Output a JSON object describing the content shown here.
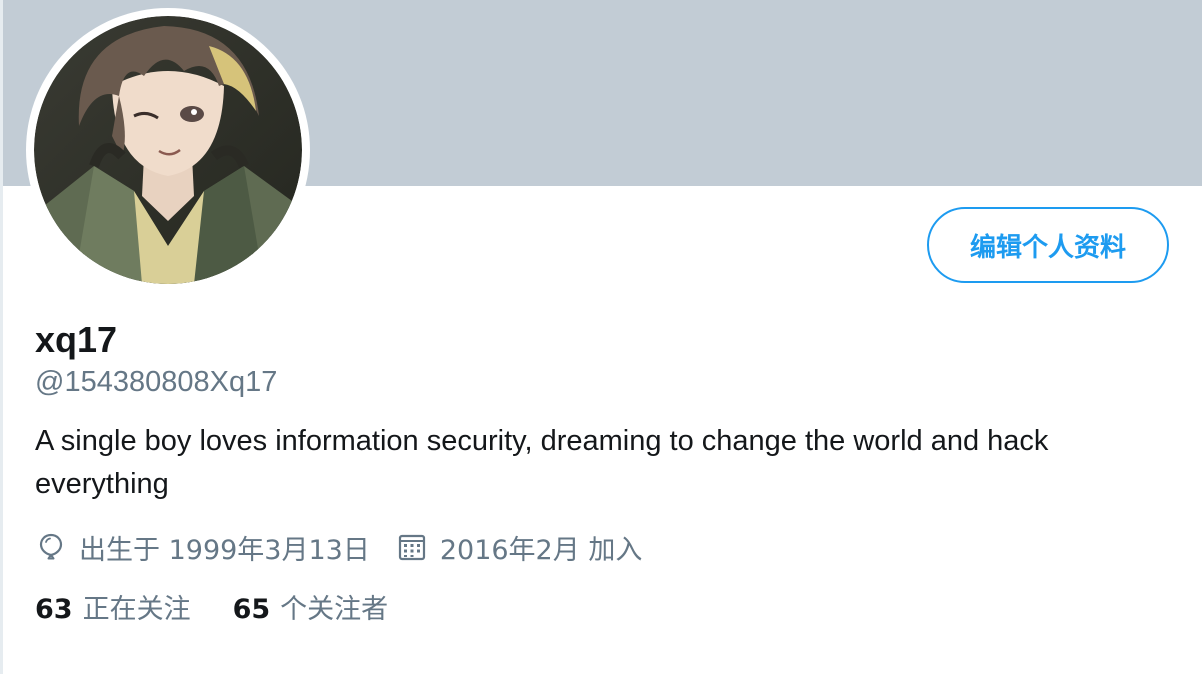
{
  "profile": {
    "display_name": "xq17",
    "handle": "@154380808Xq17",
    "bio": "A single boy loves information security, dreaming to change the world and hack everything",
    "birthday": "出生于 1999年3月13日",
    "joined": "2016年2月 加入",
    "avatar_icon": "anime-boy-avatar"
  },
  "actions": {
    "edit_profile_label": "编辑个人资料"
  },
  "stats": {
    "following_count": "63",
    "following_label": "正在关注",
    "followers_count": "65",
    "followers_label": "个关注者"
  },
  "icons": {
    "birthday": "balloon-icon",
    "joined": "calendar-icon"
  },
  "colors": {
    "banner": "#c2ccd5",
    "accent": "#1d9bf0",
    "secondary_text": "#657786",
    "primary_text": "#14171a"
  }
}
